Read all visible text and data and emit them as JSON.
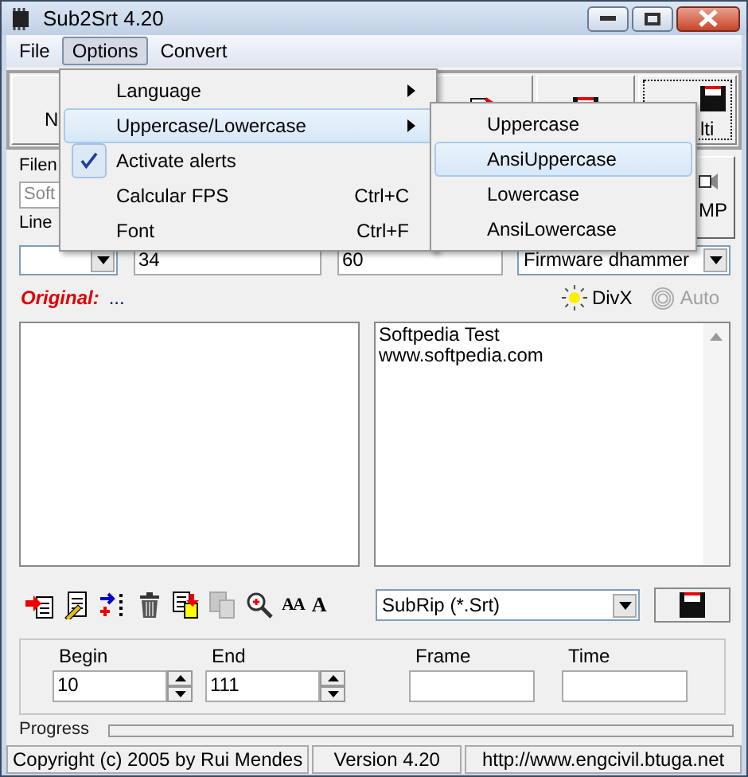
{
  "window": {
    "title": "Sub2Srt 4.20"
  },
  "menu_bar": [
    {
      "label": "File",
      "selected": false
    },
    {
      "label": "Options",
      "selected": true
    },
    {
      "label": "Convert",
      "selected": false
    }
  ],
  "options_menu": [
    {
      "label": "Language",
      "submenu": true,
      "checked": false,
      "selected": false
    },
    {
      "label": "Uppercase/Lowercase",
      "submenu": true,
      "checked": false,
      "selected": true
    },
    {
      "label": "Activate alerts",
      "submenu": false,
      "checked": true,
      "selected": false
    },
    {
      "label": "Calcular FPS",
      "shortcut": "Ctrl+C",
      "submenu": false,
      "checked": false,
      "selected": false
    },
    {
      "label": "Font",
      "shortcut": "Ctrl+F",
      "submenu": false,
      "checked": false,
      "selected": false
    }
  ],
  "case_submenu": [
    {
      "label": "Uppercase",
      "selected": false
    },
    {
      "label": "AnsiUppercase",
      "selected": true
    },
    {
      "label": "Lowercase",
      "selected": false
    },
    {
      "label": "AnsiLowercase",
      "selected": false
    }
  ],
  "toolbar": {
    "first_label": "N",
    "last_label": "lti"
  },
  "filename": {
    "label": "Filen",
    "value": "Soft"
  },
  "line_label": "Line",
  "mp_button": {
    "label": "MP"
  },
  "fields": [
    "34",
    "60"
  ],
  "firmware": {
    "value": "Firmware dhammer"
  },
  "original": {
    "label": "Original:",
    "value": "..."
  },
  "divx": {
    "label": "DivX",
    "selected": true
  },
  "auto": {
    "label": "Auto",
    "disabled": true
  },
  "subtitle_text": [
    "Softpedia Test",
    "www.softpedia.com"
  ],
  "tools": [
    {
      "kind": "import",
      "disabled": false
    },
    {
      "kind": "edit",
      "disabled": false
    },
    {
      "kind": "merge",
      "disabled": false
    },
    {
      "kind": "delete",
      "disabled": false
    },
    {
      "kind": "paste",
      "disabled": false
    },
    {
      "kind": "copy",
      "disabled": true
    },
    {
      "kind": "zoom",
      "disabled": false
    },
    {
      "kind": "glyph",
      "text": "AA"
    },
    {
      "kind": "glyph",
      "text": "A"
    }
  ],
  "format": {
    "value": "SubRip (*.Srt)"
  },
  "range": {
    "begin_label": "Begin",
    "begin": "10",
    "end_label": "End",
    "end": "111",
    "frame_label": "Frame",
    "time_label": "Time"
  },
  "progress": {
    "label": "Progress",
    "level": 0
  },
  "status_bar": [
    "Copyright (c) 2005 by Rui Mendes",
    "Version 4.20",
    "http://www.engcivil.btuga.net"
  ]
}
